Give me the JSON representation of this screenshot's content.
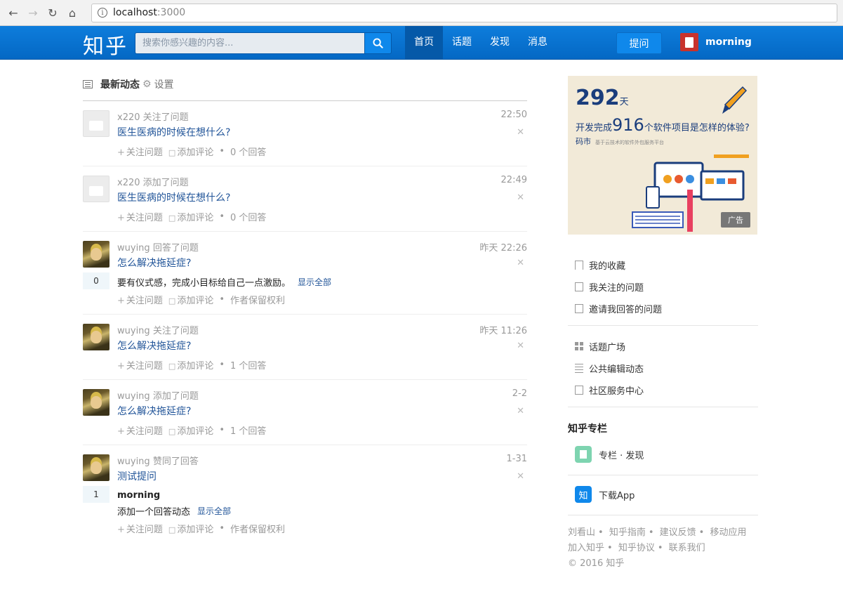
{
  "browser": {
    "host": "localhost",
    "port": ":3000"
  },
  "header": {
    "logo": "知乎",
    "search_placeholder": "搜索你感兴趣的内容...",
    "nav": [
      "首页",
      "话题",
      "发现",
      "消息"
    ],
    "ask": "提问",
    "username": "morning"
  },
  "feed": {
    "title": "最新动态",
    "settings": "设置",
    "items": [
      {
        "user": "x220",
        "action": "关注了问题",
        "time": "22:50",
        "title": "医生医病的时候在想什么?",
        "follow": "关注问题",
        "comment": "添加评论",
        "extra": "0 个回答"
      },
      {
        "user": "x220",
        "action": "添加了问题",
        "time": "22:49",
        "title": "医生医病的时候在想什么?",
        "follow": "关注问题",
        "comment": "添加评论",
        "extra": "0 个回答"
      },
      {
        "user": "wuying",
        "action": "回答了问题",
        "time": "昨天 22:26",
        "title": "怎么解决拖延症?",
        "votes": "0",
        "answer": "要有仪式感，完成小目标给自己一点激励。",
        "show_all": "显示全部",
        "follow": "关注问题",
        "comment": "添加评论",
        "extra": "作者保留权利"
      },
      {
        "user": "wuying",
        "action": "关注了问题",
        "time": "昨天 11:26",
        "title": "怎么解决拖延症?",
        "follow": "关注问题",
        "comment": "添加评论",
        "extra": "1 个回答"
      },
      {
        "user": "wuying",
        "action": "添加了问题",
        "time": "2-2",
        "title": "怎么解决拖延症?",
        "follow": "关注问题",
        "comment": "添加评论",
        "extra": "1 个回答"
      },
      {
        "user": "wuying",
        "action": "赞同了回答",
        "time": "1-31",
        "title": "测试提问",
        "votes": "1",
        "author": "morning",
        "answer": "添加一个回答动态",
        "show_all": "显示全部",
        "follow": "关注问题",
        "comment": "添加评论",
        "extra": "作者保留权利"
      }
    ]
  },
  "ad": {
    "days": "292",
    "days_unit": "天",
    "line_pre": "开发完成",
    "line_num": "916",
    "line_post": "个软件项目是怎样的体验?",
    "brand": "码市",
    "brand_sub": "基于云技术的软件外包服务平台",
    "tag": "广告"
  },
  "sidebar": {
    "group1": [
      "我的收藏",
      "我关注的问题",
      "邀请我回答的问题"
    ],
    "group2": [
      "话题广场",
      "公共编辑动态",
      "社区服务中心"
    ],
    "column_title": "知乎专栏",
    "column_item": "专栏 · 发现",
    "app_icon": "知",
    "app_item": "下载App",
    "footer1": [
      "刘看山",
      "知乎指南",
      "建议反馈",
      "移动应用"
    ],
    "footer2": [
      "加入知乎",
      "知乎协议",
      "联系我们"
    ],
    "copyright": "© 2016 知乎"
  }
}
